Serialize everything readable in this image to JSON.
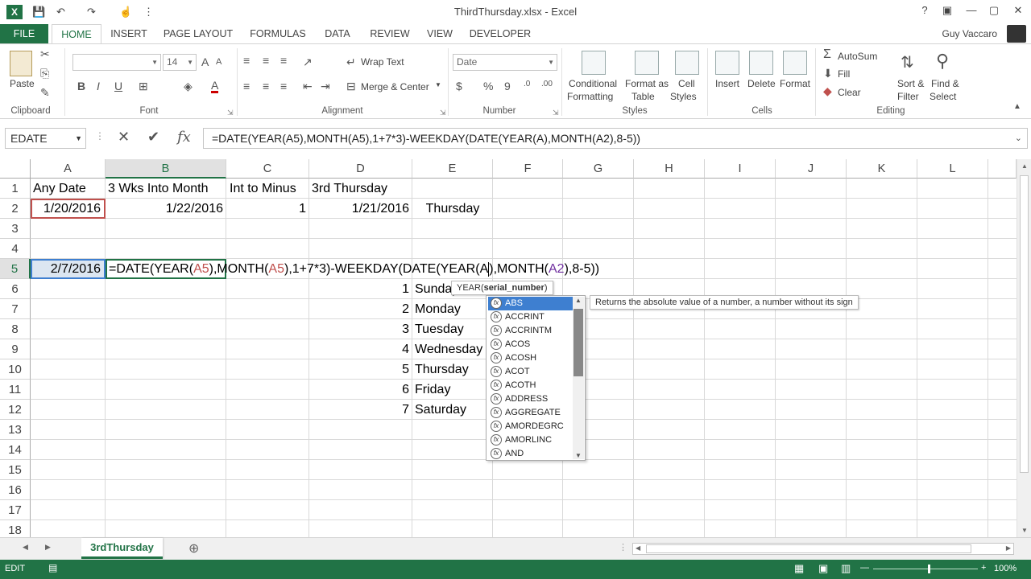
{
  "window": {
    "title": "ThirdThursday.xlsx - Excel",
    "help": "?",
    "ribbon_display": "▣",
    "minimize": "—",
    "restore": "▢",
    "close": "✕"
  },
  "qat": {
    "save": "💾",
    "undo": "↶",
    "redo": "↷",
    "touch": "☝",
    "customize": "⋮"
  },
  "ribbon_tabs": [
    "FILE",
    "HOME",
    "INSERT",
    "PAGE LAYOUT",
    "FORMULAS",
    "DATA",
    "REVIEW",
    "VIEW",
    "DEVELOPER"
  ],
  "user": {
    "name": "Guy Vaccaro"
  },
  "ribbon": {
    "clipboard": {
      "label": "Clipboard",
      "paste": "Paste"
    },
    "font": {
      "label": "Font",
      "size": "14",
      "bold": "B",
      "italic": "I",
      "underline": "U"
    },
    "alignment": {
      "label": "Alignment",
      "wrap_text": "Wrap Text",
      "merge_center": "Merge & Center"
    },
    "number": {
      "label": "Number",
      "format": "Date",
      "currency": "$",
      "percent": "%",
      "comma": "9"
    },
    "styles": {
      "label": "Styles",
      "conditional_1": "Conditional",
      "conditional_2": "Formatting",
      "format_as_1": "Format as",
      "format_as_2": "Table",
      "cell_styles_1": "Cell",
      "cell_styles_2": "Styles"
    },
    "cells": {
      "label": "Cells",
      "insert": "Insert",
      "delete": "Delete",
      "format": "Format"
    },
    "editing": {
      "label": "Editing",
      "autosum": "AutoSum",
      "fill": "Fill",
      "clear": "Clear",
      "sort_1": "Sort &",
      "sort_2": "Filter",
      "find_1": "Find &",
      "find_2": "Select"
    }
  },
  "formula_bar": {
    "name_box": "EDATE",
    "cancel": "✕",
    "enter": "✔",
    "fx": "fx",
    "formula": "=DATE(YEAR(A5),MONTH(A5),1+7*3)-WEEKDAY(DATE(YEAR(A),MONTH(A2),8-5))"
  },
  "sheet": {
    "columns": [
      "A",
      "B",
      "C",
      "D",
      "E",
      "F",
      "G",
      "H",
      "I",
      "J",
      "K",
      "L"
    ],
    "rows": [
      "1",
      "2",
      "3",
      "4",
      "5",
      "6",
      "7",
      "8",
      "9",
      "10",
      "11",
      "12",
      "13",
      "14",
      "15",
      "16",
      "17",
      "18"
    ],
    "cells": {
      "A1": "Any Date",
      "B1": "3 Wks Into Month",
      "C1": "Int to Minus",
      "D1": "3rd Thursday",
      "A2": "1/20/2016",
      "B2": "1/22/2016",
      "C2": "1",
      "D2": "1/21/2016",
      "E2": "Thursday",
      "A5": "2/7/2016",
      "D6": "1",
      "E6": "Sunday",
      "D7": "2",
      "E7": "Monday",
      "D8": "3",
      "E8": "Tuesday",
      "D9": "4",
      "E9": "Wednesday",
      "D10": "5",
      "E10": "Thursday",
      "D11": "6",
      "E11": "Friday",
      "D12": "7",
      "E12": "Saturday"
    },
    "edit_formula": {
      "p1": "=DATE(YEAR(",
      "ref1": "A5",
      "p2": "),MONTH(",
      "ref2": "A5",
      "p3": "),1+7*3)-WEEKDAY(DATE(",
      "p4": "YEAR(",
      "ref3": "A",
      "p5": "),MONTH(",
      "ref4": "A2",
      "p6": "),8-5))"
    }
  },
  "syntax_tooltip": {
    "fn": "YEAR(",
    "arg": "serial_number",
    "close": ")"
  },
  "autocomplete": {
    "items": [
      "ABS",
      "ACCRINT",
      "ACCRINTM",
      "ACOS",
      "ACOSH",
      "ACOT",
      "ACOTH",
      "ADDRESS",
      "AGGREGATE",
      "AMORDEGRC",
      "AMORLINC",
      "AND"
    ],
    "selected": "ABS",
    "description": "Returns the absolute value of a number, a number without its sign"
  },
  "sheet_tabs": {
    "active": "3rdThursday",
    "add": "⊕"
  },
  "status": {
    "mode": "EDIT",
    "zoom": "100%"
  },
  "colors": {
    "excel_green": "#217346",
    "ref_red": "#c0504d",
    "ref_purple": "#7030a0",
    "highlight": "#3e7fd0"
  }
}
